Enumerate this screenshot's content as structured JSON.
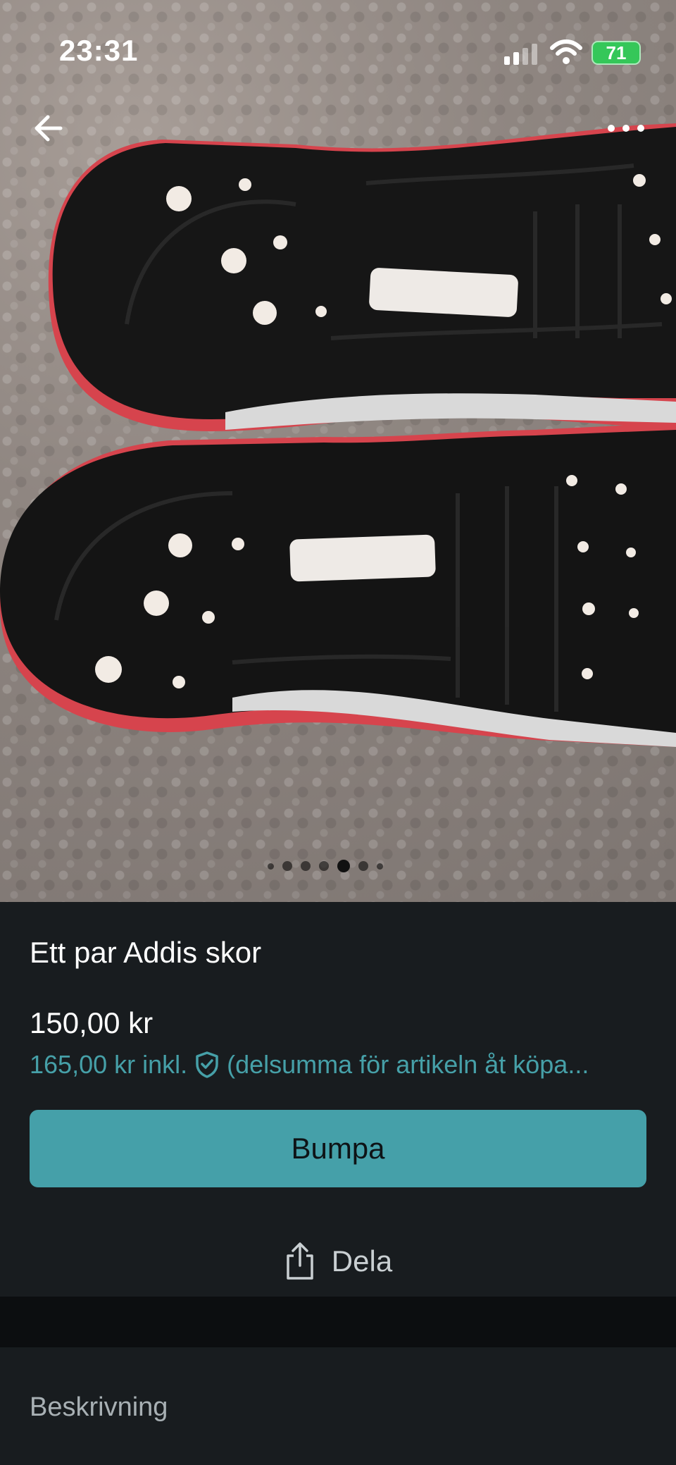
{
  "status_bar": {
    "time": "23:31",
    "battery": "71"
  },
  "product_image": {
    "description_icon": "shoe-soles-photo",
    "carousel_total": 7,
    "carousel_active_index": 4
  },
  "listing": {
    "title": "Ett par Addis skor",
    "price": "150,00 kr",
    "price_incl_prefix": "165,00 kr inkl.",
    "price_incl_suffix": "(delsumma för artikeln åt köpa...",
    "bump_label": "Bumpa",
    "share_label": "Dela"
  },
  "description": {
    "label": "Beskrivning"
  },
  "colors": {
    "accent": "#45a0a9",
    "background": "#181c1f"
  }
}
